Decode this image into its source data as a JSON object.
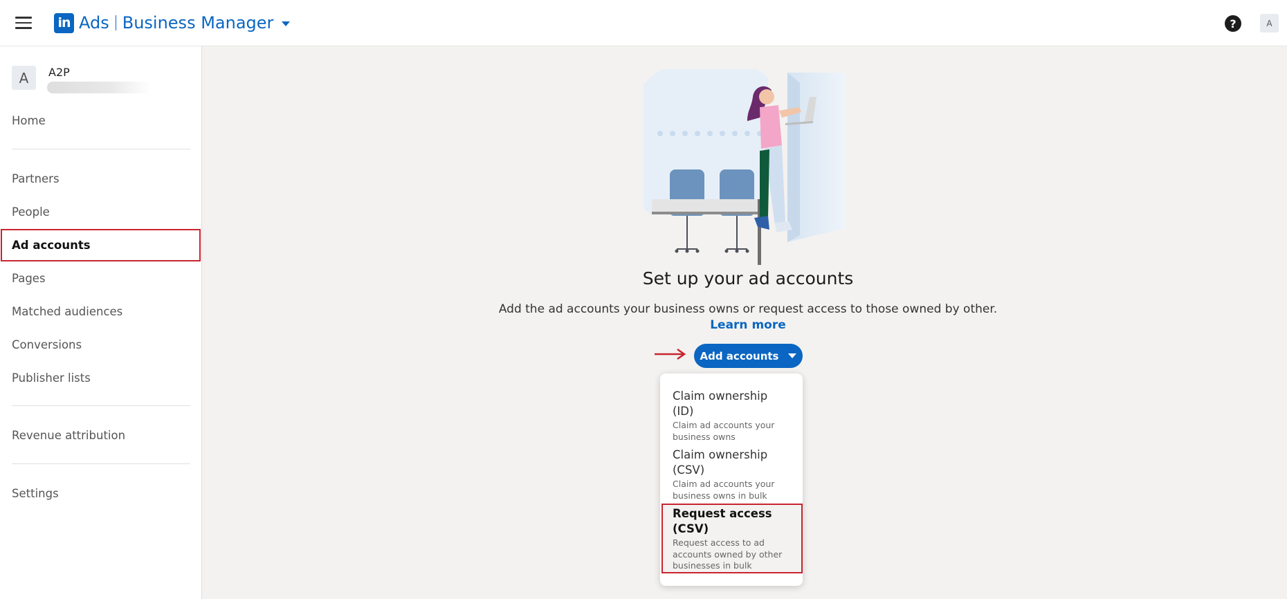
{
  "topbar": {
    "logo_text": "in",
    "brand_ads": "Ads",
    "brand_product": "Business Manager",
    "help_glyph": "?",
    "user_initial": "A"
  },
  "sidebar": {
    "org_initial": "A",
    "org_name": "A2P",
    "items": [
      {
        "label": "Home"
      },
      {
        "label": "Partners"
      },
      {
        "label": "People"
      },
      {
        "label": "Ad accounts"
      },
      {
        "label": "Pages"
      },
      {
        "label": "Matched audiences"
      },
      {
        "label": "Conversions"
      },
      {
        "label": "Publisher lists"
      },
      {
        "label": "Revenue attribution"
      },
      {
        "label": "Settings"
      }
    ],
    "active_item": "Ad accounts"
  },
  "main": {
    "title": "Set up your ad accounts",
    "subtitle": "Add the ad accounts your business owns or request access to those owned by other.",
    "learn_more": "Learn more",
    "add_button": "Add accounts",
    "menu": [
      {
        "title": "Claim ownership (ID)",
        "desc": "Claim ad accounts your business owns"
      },
      {
        "title": "Claim ownership (CSV)",
        "desc": "Claim ad accounts your business owns in bulk"
      },
      {
        "title": "Request access (CSV)",
        "desc": "Request access to ad accounts owned by other businesses in bulk"
      }
    ],
    "selected_menu_item": "Request access (CSV)"
  },
  "colors": {
    "brand": "#0a66c2",
    "highlight": "#c8242f",
    "background": "#f3f2f0"
  }
}
